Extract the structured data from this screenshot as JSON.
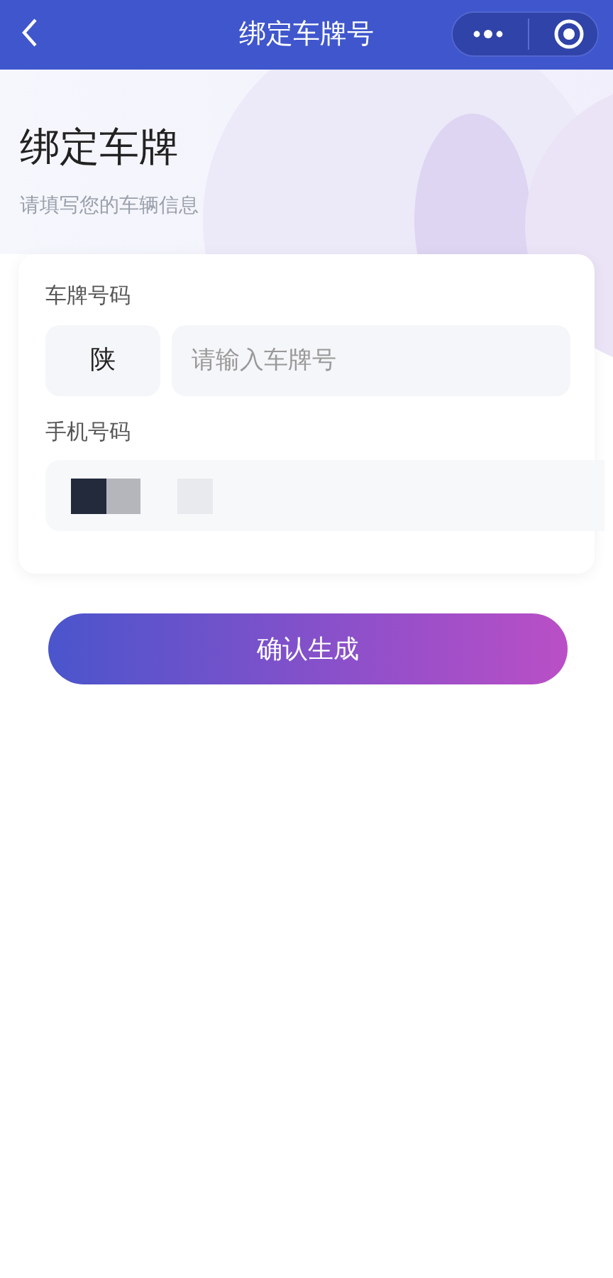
{
  "nav_bar": {
    "title": "绑定车牌号"
  },
  "heading": "绑定车牌",
  "subtitle": "请填写您的车辆信息",
  "form": {
    "plate": {
      "label": "车牌号码",
      "province": "陕",
      "placeholder": "请输入车牌号"
    },
    "phone": {
      "label": "手机号码",
      "redacted": true
    }
  },
  "submit_button": "确认生成"
}
